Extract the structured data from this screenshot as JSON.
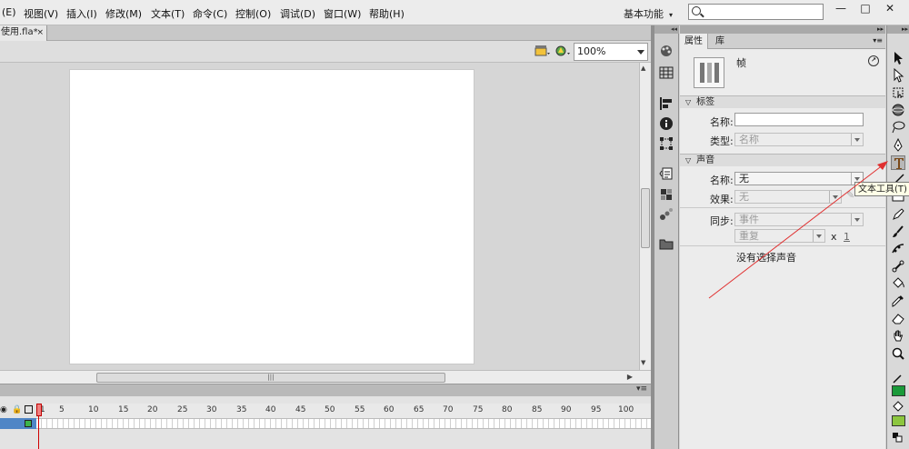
{
  "menu": {
    "items": [
      "(E)",
      "视图(V)",
      "插入(I)",
      "修改(M)",
      "文本(T)",
      "命令(C)",
      "控制(O)",
      "调试(D)",
      "窗口(W)",
      "帮助(H)"
    ],
    "workspace": "基本功能",
    "search_value": ""
  },
  "window_controls": {
    "minimize": "—",
    "maximize": "□",
    "close": "✕"
  },
  "document_tab": {
    "name": "使用.fla*",
    "close": "×"
  },
  "editbar": {
    "zoom": "100%"
  },
  "timeline": {
    "ruler": [
      "1",
      "5",
      "10",
      "15",
      "20",
      "25",
      "30",
      "35",
      "40",
      "45",
      "50",
      "55",
      "60",
      "65",
      "70",
      "75",
      "80",
      "85",
      "90",
      "95",
      "100"
    ],
    "current_frame": "1"
  },
  "props": {
    "tabs": [
      "属性",
      "库"
    ],
    "frame_title": "帧",
    "label_section": "标签",
    "name_label": "名称:",
    "name_value": "",
    "type_label": "类型:",
    "type_value": "名称",
    "sound_section": "声音",
    "sound_name_label": "名称:",
    "sound_name_value": "无",
    "effect_label": "效果:",
    "effect_value": "无",
    "sync_label": "同步:",
    "sync_value": "事件",
    "repeat_value": "重复",
    "x_label": "x",
    "repeat_count": "1",
    "no_sound": "没有选择声音"
  },
  "tooltip": "文本工具(T)",
  "colors": {
    "stroke": "#1a9a3a",
    "fill": "#8cc63f",
    "annotation": "#e03030"
  }
}
